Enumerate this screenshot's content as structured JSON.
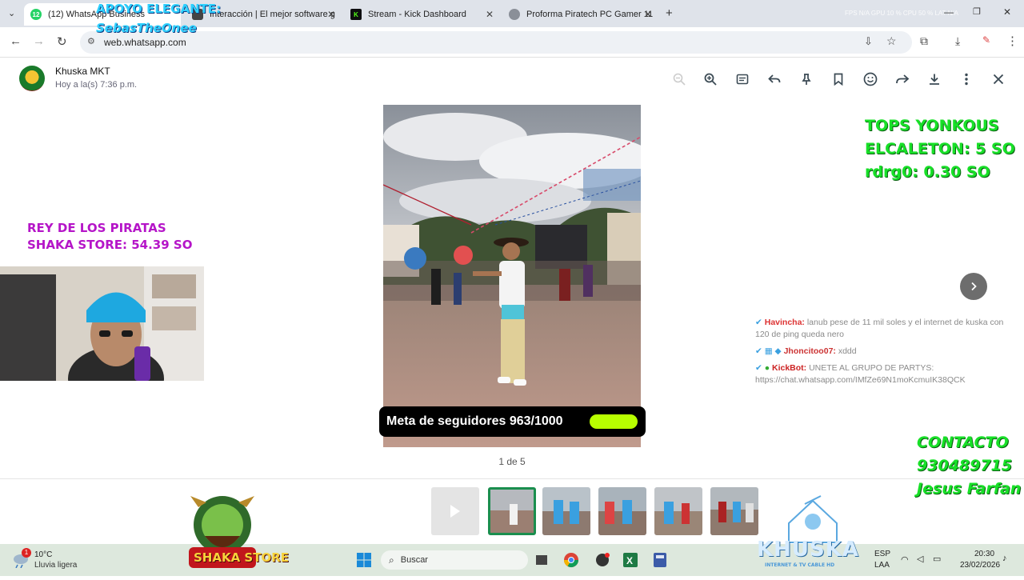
{
  "browser": {
    "tabs": [
      {
        "label": "(12) WhatsApp Business",
        "badge": "12",
        "active": true
      },
      {
        "label": "Interacción | El mejor software g"
      },
      {
        "label": "Stream - Kick Dashboard"
      },
      {
        "label": "Proforma Piratech PC Gamer 11"
      }
    ],
    "perf_overlay": "FPS N/A    GPU 10 %    CPU 50 %    LAT N/A",
    "url": "web.whatsapp.com"
  },
  "media": {
    "contact_name": "Khuska MKT",
    "timestamp": "Hoy a la(s) 7:36 p.m.",
    "counter": "1 de 5",
    "goal_text": "Meta de seguidores 963/1000",
    "goal_progress": 0.963,
    "header_icons": [
      "zoom-out-icon",
      "zoom-in-icon",
      "caption-icon",
      "reply-icon",
      "pin-icon",
      "bookmark-icon",
      "emoji-icon",
      "forward-icon",
      "download-icon",
      "more-icon",
      "close-icon"
    ]
  },
  "overlays": {
    "support": [
      "APOYO ELEGANTE:",
      "SebasTheOnee"
    ],
    "pirates": [
      "REY DE LOS PIRATAS",
      "SHAKA STORE: 54.39 SO"
    ],
    "tops": [
      "TOPS YONKOUS",
      "ELCALETON: 5 SO",
      "rdrg0: 0.30 SO"
    ],
    "contact": [
      "CONTACTO",
      "930489715",
      "Jesus Farfan"
    ],
    "brand_left": "SHAKA STORE",
    "brand_right": "KHUSKA",
    "brand_right_sub": "INTERNET & TV CABLE HD"
  },
  "chat": [
    {
      "user": "Havincha:",
      "msg": "lanub pese de 11 mil soles y el internet de kuska con 120 de ping queda nero",
      "color": "#d33"
    },
    {
      "user": "Jhoncitoo07:",
      "msg": "xddd",
      "color": "#c33"
    },
    {
      "user": "KickBot:",
      "msg": "UNETE AL GRUPO DE PARTYS: https://chat.whatsapp.com/IMfZe69N1moKcmuIK38QCK",
      "color": "#c22"
    }
  ],
  "taskbar": {
    "weather_temp": "10°C",
    "weather_desc": "Lluvia ligera",
    "weather_badge": "1",
    "search": "Buscar",
    "lang1": "ESP",
    "lang2": "LAA",
    "time": "20:30",
    "date": "23/02/2026"
  }
}
